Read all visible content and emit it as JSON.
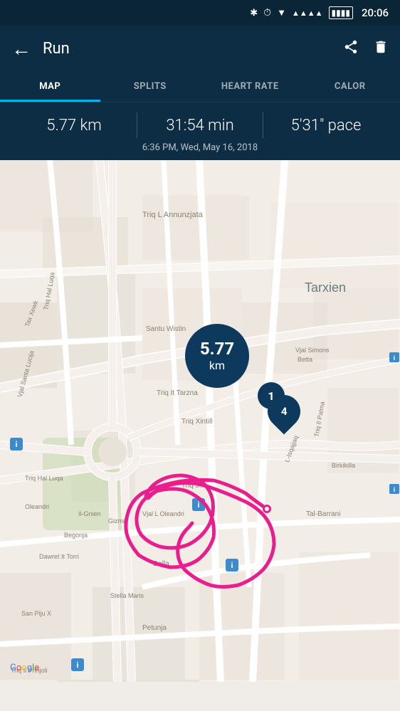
{
  "statusBar": {
    "time": "20:06",
    "icons": [
      "bluetooth",
      "alarm",
      "wifi",
      "signal",
      "battery"
    ]
  },
  "navBar": {
    "title": "Run",
    "backIcon": "←",
    "shareIcon": "share",
    "deleteIcon": "delete"
  },
  "tabs": [
    {
      "id": "map",
      "label": "MAP",
      "active": true
    },
    {
      "id": "splits",
      "label": "SPLITS",
      "active": false
    },
    {
      "id": "heartrate",
      "label": "HEART RATE",
      "active": false
    },
    {
      "id": "calories",
      "label": "CALOR",
      "active": false
    }
  ],
  "stats": {
    "distance": "5.77 km",
    "duration": "31:54 min",
    "pace": "5'31\" pace",
    "datetime": "6:36 PM, Wed, May 16, 2018"
  },
  "map": {
    "distanceMarker": "5.77",
    "distanceUnit": "km",
    "lap1Label": "1",
    "finishLabel": "4",
    "googleLabel": "Google"
  }
}
